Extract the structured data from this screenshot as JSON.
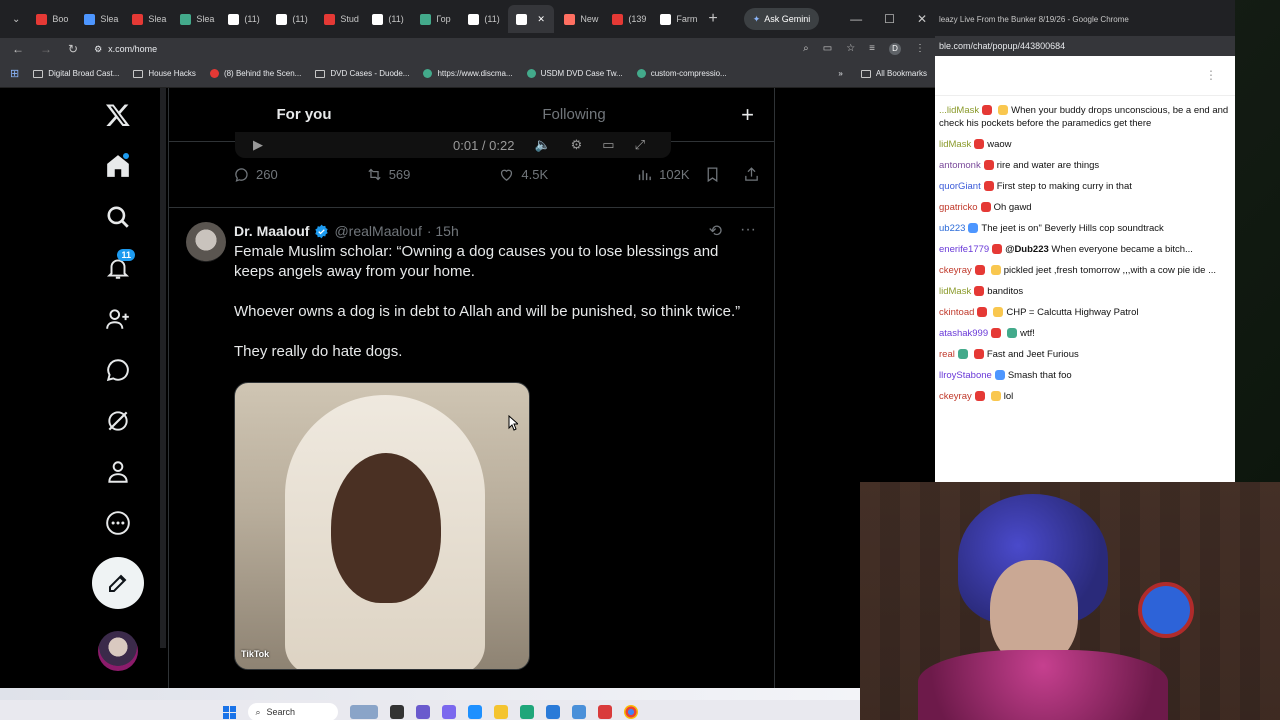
{
  "browser": {
    "tabs": [
      {
        "label": "Boo",
        "color": "#e53935"
      },
      {
        "label": "Slea",
        "color": "#4d96ff"
      },
      {
        "label": "Slea",
        "color": "#e53935"
      },
      {
        "label": "Slea",
        "color": "#43aa8b"
      },
      {
        "label": "(11)",
        "color": "#ffffff"
      },
      {
        "label": "(11)",
        "color": "#ffffff"
      },
      {
        "label": "Stud",
        "color": "#e53935"
      },
      {
        "label": "(11)",
        "color": "#ffffff"
      },
      {
        "label": "Гор",
        "color": "#43aa8b"
      },
      {
        "label": "(11)",
        "color": "#ffffff"
      },
      {
        "label": "",
        "color": "#ffffff"
      },
      {
        "label": "New",
        "color": "#ff6f61"
      },
      {
        "label": "(139",
        "color": "#e53935"
      },
      {
        "label": "Farm",
        "color": "#ffffff"
      }
    ],
    "ask_gemini": "Ask Gemini",
    "url": "x.com/home",
    "bookmarks": [
      {
        "label": "Digital Broad Cast...",
        "icon": "folder"
      },
      {
        "label": "House Hacks",
        "icon": "folder"
      },
      {
        "label": "(8) Behind the Scen...",
        "icon": "youtube"
      },
      {
        "label": "DVD Cases - Duode...",
        "icon": "folder"
      },
      {
        "label": "https://www.discma...",
        "icon": "site"
      },
      {
        "label": "USDM DVD Case Tw...",
        "icon": "site"
      },
      {
        "label": "custom-compressio...",
        "icon": "site"
      }
    ],
    "all_bookmarks": "All Bookmarks"
  },
  "x": {
    "nav_badge_notifications": "11",
    "tab_for_you": "For you",
    "tab_following": "Following",
    "video_time": "0:01 / 0:22",
    "prev_post": {
      "replies": "260",
      "reposts": "569",
      "likes": "4.5K",
      "views": "102K"
    },
    "post": {
      "name": "Dr. Maalouf",
      "handle": "@realMaalouf",
      "time": "· 15h",
      "text1": "Female Muslim scholar: “Owning a dog causes you to lose blessings and keeps angels away from your home.",
      "text2": "Whoever owns a dog is in debt to Allah and will be punished, so think twice.”",
      "text3": "They really do hate dogs.",
      "media_watermark": "TikTok"
    },
    "accent": "#1d9bf0"
  },
  "popup": {
    "title": "leazy Live From the Bunker 8/19/26 - Google Chrome",
    "url": "ble.com/chat/popup/443800684",
    "messages": [
      {
        "user": "...lidMask",
        "user_color": "#8a9a2a",
        "badges": [
          "r",
          "y"
        ],
        "text": "When your buddy drops unconscious, be a end and check his pockets before the paramedics get there"
      },
      {
        "user": "lidMask",
        "user_color": "#8a9a2a",
        "badges": [
          "r"
        ],
        "text": "waow"
      },
      {
        "user": "antomonk",
        "user_color": "#7a4a9a",
        "badges": [
          "r"
        ],
        "text": "rire and water are things"
      },
      {
        "user": "quorGiant",
        "user_color": "#3a5ad8",
        "badges": [
          "r"
        ],
        "text": "First step to making curry in that"
      },
      {
        "user": "gpatricko",
        "user_color": "#c0392b",
        "badges": [
          "r"
        ],
        "text": "Oh gawd"
      },
      {
        "user": "ub223",
        "user_color": "#2a6ad8",
        "badges": [
          "b"
        ],
        "text": "The jeet is on\" Beverly Hills cop soundtrack"
      },
      {
        "user": "enerife1779",
        "user_color": "#6a3ad8",
        "badges": [
          "r"
        ],
        "mention": "@Dub223",
        "text": "When everyone became a bitch..."
      },
      {
        "user": "ckeyray",
        "user_color": "#c0392b",
        "badges": [
          "r",
          "y"
        ],
        "text": "pickled jeet ,fresh tomorrow ,,,with a cow pie ide ..."
      },
      {
        "user": "lidMask",
        "user_color": "#8a9a2a",
        "badges": [
          "r"
        ],
        "text": "banditos"
      },
      {
        "user": "ckintoad",
        "user_color": "#c0392b",
        "badges": [
          "r",
          "y"
        ],
        "text": "CHP = Calcutta Highway Patrol"
      },
      {
        "user": "atashak999",
        "user_color": "#6a3ad8",
        "badges": [
          "r",
          "g"
        ],
        "text": "wtf!"
      },
      {
        "user": "real",
        "user_color": "#c0392b",
        "badges": [
          "g",
          "r"
        ],
        "text": "Fast and Jeet Furious"
      },
      {
        "user": "llroyStabone",
        "user_color": "#6a3ad8",
        "badges": [
          "b"
        ],
        "text": "Smash that foo"
      },
      {
        "user": "ckeyray",
        "user_color": "#c0392b",
        "badges": [
          "r",
          "y"
        ],
        "text": "lol"
      }
    ]
  },
  "taskbar": {
    "search": "Search"
  }
}
